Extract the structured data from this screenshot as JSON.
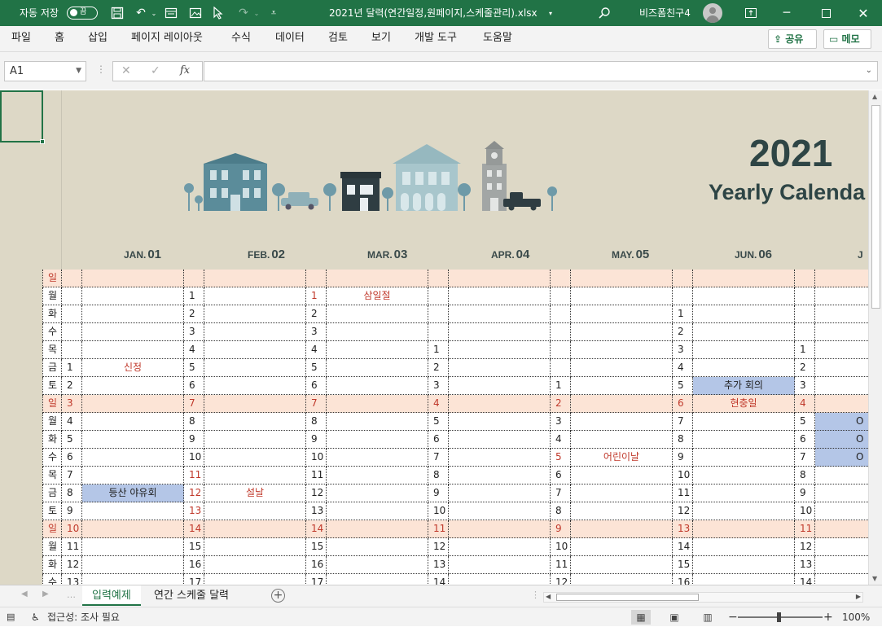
{
  "titlebar": {
    "autosave_label": "자동 저장",
    "autosave_state": "끔",
    "filename": "2021년 달력(연간일정,원페이지,스케줄관리).xlsx",
    "user": "비즈폼친구4"
  },
  "menu": {
    "items": [
      "파일",
      "홈",
      "삽입",
      "페이지 레이아웃",
      "수식",
      "데이터",
      "검토",
      "보기",
      "개발 도구",
      "도움말"
    ],
    "share": "공유",
    "comment": "메모"
  },
  "formula": {
    "namebox": "A1",
    "fx": "fx",
    "value": ""
  },
  "calendar": {
    "year": "2021",
    "subtitle": "Yearly Calenda",
    "months": [
      {
        "abbr": "JAN.",
        "num": "01"
      },
      {
        "abbr": "FEB.",
        "num": "02"
      },
      {
        "abbr": "MAR.",
        "num": "03"
      },
      {
        "abbr": "APR.",
        "num": "04"
      },
      {
        "abbr": "MAY.",
        "num": "05"
      },
      {
        "abbr": "JUN.",
        "num": "06"
      },
      {
        "abbr": "J",
        "num": ""
      }
    ],
    "weekdays": [
      "일",
      "월",
      "화",
      "수",
      "목",
      "금",
      "토",
      "일",
      "월",
      "화",
      "수",
      "목",
      "금",
      "토",
      "일",
      "월",
      "화",
      "수"
    ],
    "rows": [
      {
        "jan": "",
        "feb": "",
        "mar": "",
        "apr": "",
        "may": "",
        "jun": "",
        "jul": "",
        "e_jan": "",
        "e_feb": "",
        "e_mar": "",
        "e_apr": "",
        "e_may": "",
        "e_jun": "",
        "e_jul": ""
      },
      {
        "jan": "",
        "feb": "1",
        "mar": "1",
        "apr": "",
        "may": "",
        "jun": "",
        "jul": "",
        "e_jan": "",
        "e_feb": "",
        "e_mar": "삼일절",
        "e_apr": "",
        "e_may": "",
        "e_jun": "",
        "e_jul": ""
      },
      {
        "jan": "",
        "feb": "2",
        "mar": "2",
        "apr": "",
        "may": "",
        "jun": "1",
        "jul": "",
        "e_jan": "",
        "e_feb": "",
        "e_mar": "",
        "e_apr": "",
        "e_may": "",
        "e_jun": "",
        "e_jul": ""
      },
      {
        "jan": "",
        "feb": "3",
        "mar": "3",
        "apr": "",
        "may": "",
        "jun": "2",
        "jul": "",
        "e_jan": "",
        "e_feb": "",
        "e_mar": "",
        "e_apr": "",
        "e_may": "",
        "e_jun": "",
        "e_jul": ""
      },
      {
        "jan": "",
        "feb": "4",
        "mar": "4",
        "apr": "1",
        "may": "",
        "jun": "3",
        "jul": "1",
        "e_jan": "",
        "e_feb": "",
        "e_mar": "",
        "e_apr": "",
        "e_may": "",
        "e_jun": "",
        "e_jul": ""
      },
      {
        "jan": "1",
        "feb": "5",
        "mar": "5",
        "apr": "2",
        "may": "",
        "jun": "4",
        "jul": "2",
        "e_jan": "신정",
        "e_feb": "",
        "e_mar": "",
        "e_apr": "",
        "e_may": "",
        "e_jun": "",
        "e_jul": ""
      },
      {
        "jan": "2",
        "feb": "6",
        "mar": "6",
        "apr": "3",
        "may": "1",
        "jun": "5",
        "jul": "3",
        "e_jan": "",
        "e_feb": "",
        "e_mar": "",
        "e_apr": "",
        "e_may": "",
        "e_jun": "추가 회의",
        "e_jul": ""
      },
      {
        "jan": "3",
        "feb": "7",
        "mar": "7",
        "apr": "4",
        "may": "2",
        "jun": "6",
        "jul": "4",
        "e_jan": "",
        "e_feb": "",
        "e_mar": "",
        "e_apr": "",
        "e_may": "",
        "e_jun": "현충일",
        "e_jul": ""
      },
      {
        "jan": "4",
        "feb": "8",
        "mar": "8",
        "apr": "5",
        "may": "3",
        "jun": "7",
        "jul": "5",
        "e_jan": "",
        "e_feb": "",
        "e_mar": "",
        "e_apr": "",
        "e_may": "",
        "e_jun": "",
        "e_jul": "O"
      },
      {
        "jan": "5",
        "feb": "9",
        "mar": "9",
        "apr": "6",
        "may": "4",
        "jun": "8",
        "jul": "6",
        "e_jan": "",
        "e_feb": "",
        "e_mar": "",
        "e_apr": "",
        "e_may": "",
        "e_jun": "",
        "e_jul": "O"
      },
      {
        "jan": "6",
        "feb": "10",
        "mar": "10",
        "apr": "7",
        "may": "5",
        "jun": "9",
        "jul": "7",
        "e_jan": "",
        "e_feb": "",
        "e_mar": "",
        "e_apr": "",
        "e_may": "어린이날",
        "e_jun": "",
        "e_jul": "O"
      },
      {
        "jan": "7",
        "feb": "11",
        "mar": "11",
        "apr": "8",
        "may": "6",
        "jun": "10",
        "jul": "8",
        "e_jan": "",
        "e_feb": "",
        "e_mar": "",
        "e_apr": "",
        "e_may": "",
        "e_jun": "",
        "e_jul": ""
      },
      {
        "jan": "8",
        "feb": "12",
        "mar": "12",
        "apr": "9",
        "may": "7",
        "jun": "11",
        "jul": "9",
        "e_jan": "등산 야유회",
        "e_feb": "설날",
        "e_mar": "",
        "e_apr": "",
        "e_may": "",
        "e_jun": "",
        "e_jul": ""
      },
      {
        "jan": "9",
        "feb": "13",
        "mar": "13",
        "apr": "10",
        "may": "8",
        "jun": "12",
        "jul": "10",
        "e_jan": "",
        "e_feb": "",
        "e_mar": "",
        "e_apr": "",
        "e_may": "",
        "e_jun": "",
        "e_jul": ""
      },
      {
        "jan": "10",
        "feb": "14",
        "mar": "14",
        "apr": "11",
        "may": "9",
        "jun": "13",
        "jul": "11",
        "e_jan": "",
        "e_feb": "",
        "e_mar": "",
        "e_apr": "",
        "e_may": "",
        "e_jun": "",
        "e_jul": ""
      },
      {
        "jan": "11",
        "feb": "15",
        "mar": "15",
        "apr": "12",
        "may": "10",
        "jun": "14",
        "jul": "12",
        "e_jan": "",
        "e_feb": "",
        "e_mar": "",
        "e_apr": "",
        "e_may": "",
        "e_jun": "",
        "e_jul": ""
      },
      {
        "jan": "12",
        "feb": "16",
        "mar": "16",
        "apr": "13",
        "may": "11",
        "jun": "15",
        "jul": "13",
        "e_jan": "",
        "e_feb": "",
        "e_mar": "",
        "e_apr": "",
        "e_may": "",
        "e_jun": "",
        "e_jul": ""
      },
      {
        "jan": "13",
        "feb": "17",
        "mar": "17",
        "apr": "14",
        "may": "12",
        "jun": "16",
        "jul": "14",
        "e_jan": "",
        "e_feb": "",
        "e_mar": "",
        "e_apr": "",
        "e_may": "",
        "e_jun": "",
        "e_jul": ""
      }
    ],
    "red_dates": {
      "feb": [
        "11",
        "12",
        "13"
      ],
      "mar": [
        "1"
      ],
      "may": [
        "5"
      ]
    }
  },
  "tabs": [
    "입력예제",
    "연간 스케줄 달력"
  ],
  "status": {
    "accessibility": "접근성: 조사 필요",
    "zoom": "100%"
  },
  "colors": {
    "excel_green": "#217346",
    "header_bg": "#ddd8c6",
    "sunday_bg": "#fce4d6",
    "event_bg": "#b4c6e7",
    "holiday_text": "#c0392b"
  }
}
